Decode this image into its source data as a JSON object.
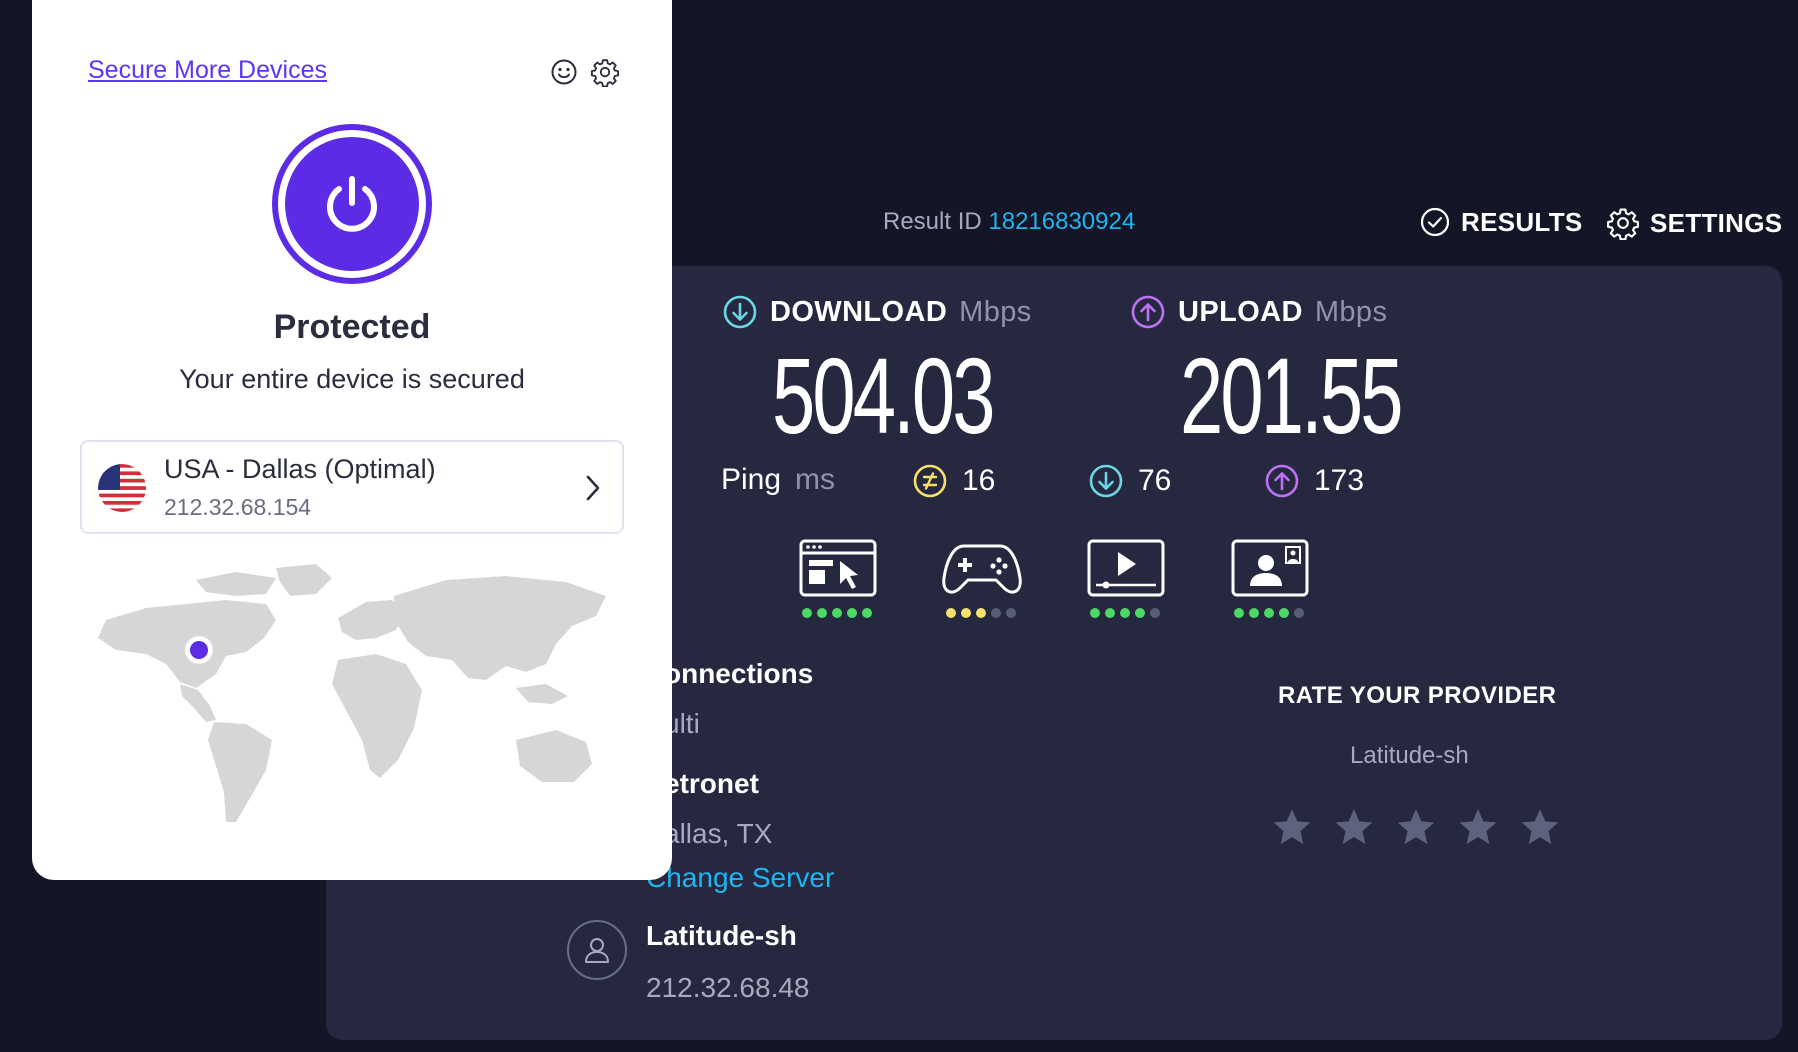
{
  "speedtest": {
    "result_id_label": "Result ID",
    "result_id": "18216830924",
    "results_label": "RESULTS",
    "settings_label": "SETTINGS",
    "download": {
      "label": "DOWNLOAD",
      "unit": "Mbps",
      "value": "504.03",
      "color": "#6ad7e5"
    },
    "upload": {
      "label": "UPLOAD",
      "unit": "Mbps",
      "value": "201.55",
      "color": "#bf71f5"
    },
    "ping": {
      "label": "Ping",
      "unit": "ms",
      "idle": "16",
      "download": "76",
      "upload": "173"
    },
    "use_cases": [
      {
        "icon": "web-browsing-icon",
        "rating": 5,
        "dot_color": "#4cd964"
      },
      {
        "icon": "gaming-icon",
        "rating": 3,
        "dot_color": "#f5e16b"
      },
      {
        "icon": "video-streaming-icon",
        "rating": 4,
        "dot_color": "#4cd964"
      },
      {
        "icon": "video-chat-icon",
        "rating": 4,
        "dot_color": "#4cd964"
      }
    ],
    "connections_title": "onnections",
    "connections_value": "ulti",
    "server_name": "etronet",
    "server_location": "allas, TX",
    "change_server": "Change Server",
    "host_name": "Latitude-sh",
    "host_ip": "212.32.68.48",
    "rate_provider": "RATE YOUR PROVIDER",
    "rate_isp": "Latitude-sh",
    "star_count": 5
  },
  "vpn": {
    "secure_more": "Secure More Devices",
    "status": "Protected",
    "description": "Your entire device is secured",
    "location": {
      "name": "USA - Dallas (Optimal)",
      "ip": "212.32.68.154",
      "flag": "us-flag-icon"
    },
    "accent_color": "#5b2be6"
  }
}
